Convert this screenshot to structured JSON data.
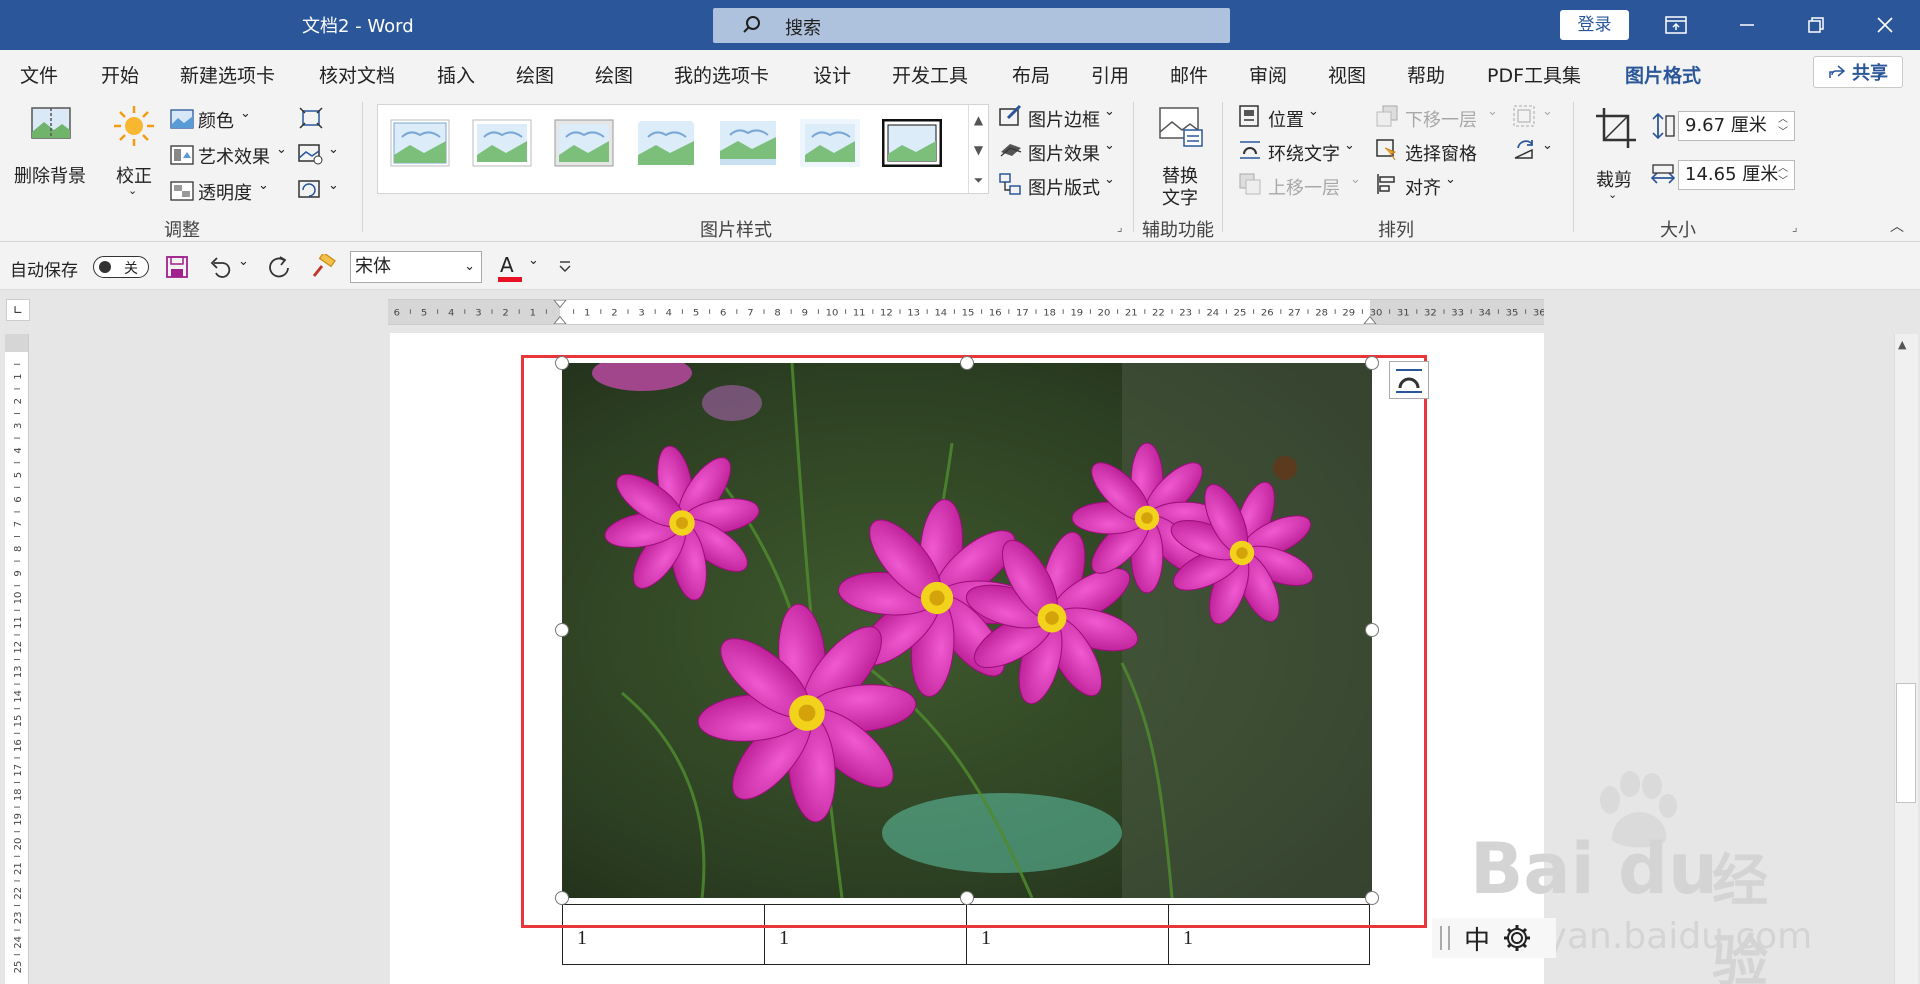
{
  "titlebar": {
    "title": "文档2  -  Word",
    "search_placeholder": "搜索",
    "login": "登录"
  },
  "tabs": [
    "文件",
    "开始",
    "新建选项卡",
    "核对文档",
    "插入",
    "绘图",
    "绘图",
    "我的选项卡",
    "设计",
    "开发工具",
    "布局",
    "引用",
    "邮件",
    "审阅",
    "视图",
    "帮助",
    "PDF工具集",
    "图片格式"
  ],
  "active_tab": "图片格式",
  "share": "共享",
  "ribbon": {
    "remove_bg": "删除背景",
    "correct": "校正",
    "color": "颜色",
    "art_effect": "艺术效果",
    "transparency": "透明度",
    "group_adjust": "调整",
    "picture_border": "图片边框",
    "picture_effect": "图片效果",
    "picture_layout": "图片版式",
    "group_styles": "图片样式",
    "alt_text_1": "替换",
    "alt_text_2": "文字",
    "group_access": "辅助功能",
    "position": "位置",
    "wrap_text": "环绕文字",
    "bring_forward": "上移一层",
    "send_backward": "下移一层",
    "selection_pane": "选择窗格",
    "align": "对齐",
    "group_arrange": "排列",
    "crop": "裁剪",
    "height": "9.67 厘米",
    "width": "14.65 厘米",
    "group_size": "大小"
  },
  "qat": {
    "autosave": "自动保存",
    "autosave_state": "关",
    "font": "宋体"
  },
  "table_cells": [
    "1",
    "1",
    "1",
    "1"
  ],
  "ime": {
    "mode": "中"
  },
  "watermark": {
    "brand": "Bai",
    "brand2": "du",
    "cn": "经验",
    "url": "jingyan.baidu.com"
  },
  "colors": {
    "titlebar": "#2b579a",
    "selection": "#e8363b",
    "accent": "#2b579a"
  }
}
